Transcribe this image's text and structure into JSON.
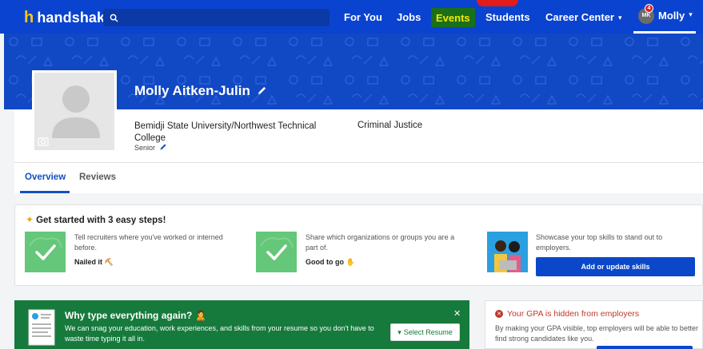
{
  "nav": {
    "logo_mark": "h",
    "logo_text": "handshake",
    "items": [
      {
        "label": "For You"
      },
      {
        "label": "Jobs"
      },
      {
        "label": "Events"
      },
      {
        "label": "Students"
      },
      {
        "label": "Career Center"
      }
    ],
    "career_center_chevron": "▾",
    "user": {
      "initials": "MK",
      "badge_count": "4",
      "name": "Molly",
      "chevron": "▾"
    }
  },
  "profile": {
    "name": "Molly Aitken-Julin",
    "school": "Bemidji State University/Northwest Technical College",
    "major": "Criminal Justice",
    "class_year": "Senior"
  },
  "tabs": [
    {
      "label": "Overview"
    },
    {
      "label": "Reviews"
    }
  ],
  "steps_card": {
    "title": "Get started with 3 easy steps!",
    "steps": [
      {
        "text": "Tell recruiters where you've worked or interned before.",
        "status": "Nailed it"
      },
      {
        "text": "Share which organizations or groups you are a part of.",
        "status": "Good to go"
      },
      {
        "text": "Showcase your top skills to stand out to employers.",
        "button": "Add or update skills"
      }
    ]
  },
  "resume_card": {
    "title": "Why type everything again?",
    "text": "We can snag your education, work experiences, and skills from your resume so you don't have to waste time typing it all in.",
    "button": "Select Resume",
    "close": "✕"
  },
  "gpa_card": {
    "title": "Your GPA is hidden from employers",
    "text": "By making your GPA visible, top employers will be able to better find strong candidates like you."
  },
  "colors": {
    "nav_blue": "#0a43cf",
    "events_bg": "#1a6f1a",
    "events_text": "#f7e800",
    "resume_green": "#167a3c",
    "check_green": "#64c779",
    "gpa_red": "#c0392b"
  }
}
